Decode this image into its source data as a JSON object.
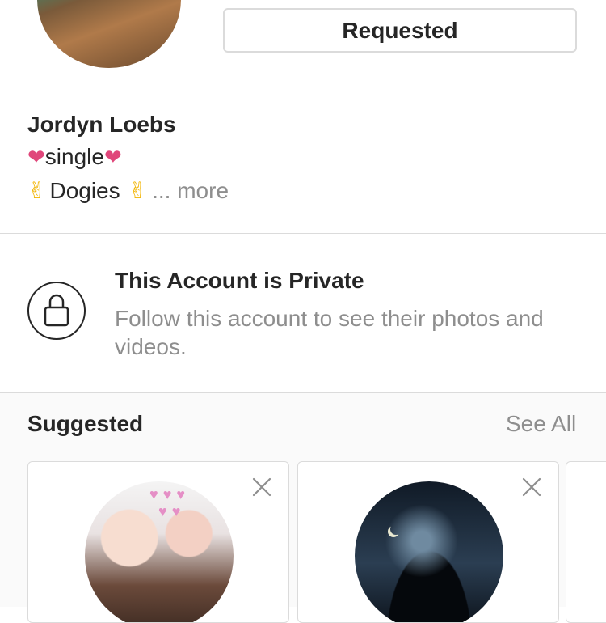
{
  "header": {
    "requested_label": "Requested"
  },
  "profile": {
    "name": "Jordyn Loebs",
    "bio_line1_text": "single",
    "bio_line2_text": "Dogies",
    "more_label": "... more"
  },
  "private_notice": {
    "title": "This Account is Private",
    "subtitle": "Follow this account to see their photos and videos."
  },
  "suggested": {
    "title": "Suggested",
    "see_all_label": "See All",
    "cards": [
      {
        "avatar": "two-girls-selfie"
      },
      {
        "avatar": "night-silhouette"
      }
    ]
  },
  "icons": {
    "heart_icon": "heart-icon",
    "peace_icon": "victory-hand-icon",
    "lock_icon": "lock-icon",
    "close_icon": "close-icon"
  },
  "colors": {
    "heart": "#e0467a",
    "muted_text": "#8e8e8e",
    "border": "#dbdbdb"
  }
}
